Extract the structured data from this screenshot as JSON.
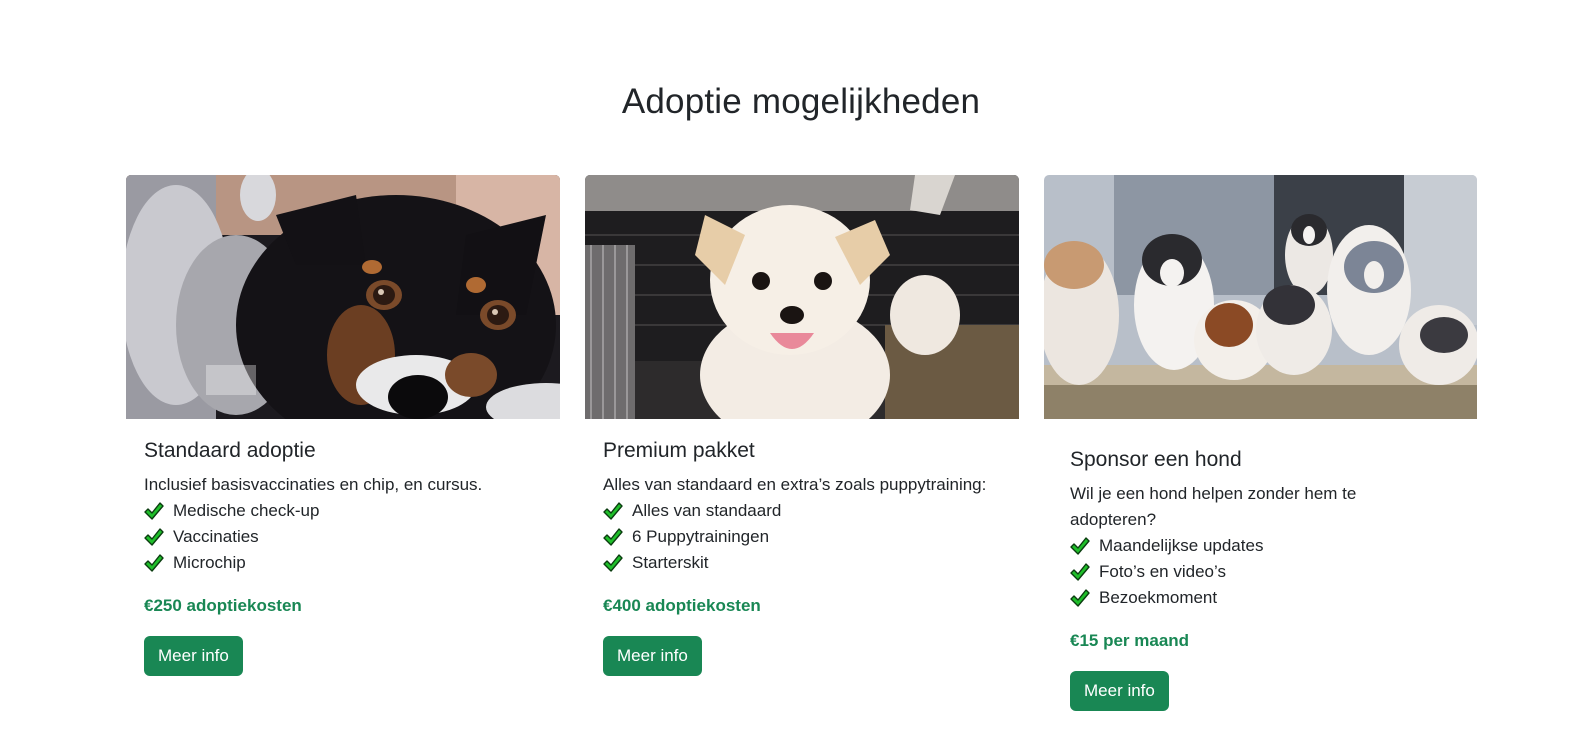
{
  "section": {
    "title": "Adoptie mogelijkheden"
  },
  "cards": [
    {
      "title": "Standaard adoptie",
      "description": "Inclusief basisvaccinaties en chip, en cursus.",
      "features": [
        "Medische check-up",
        "Vaccinaties",
        "Microchip"
      ],
      "price": "€250 adoptiekosten",
      "button": "Meer info",
      "image_icon": "black-dog-photo"
    },
    {
      "title": "Premium pakket",
      "description": "Alles van standaard en extra’s zoals puppytraining:",
      "features": [
        "Alles van standaard",
        "6 Puppytrainingen",
        "Starterskit"
      ],
      "price": "€400 adoptiekosten",
      "button": "Meer info",
      "image_icon": "white-dog-photo"
    },
    {
      "title": "Sponsor een hond",
      "description": "Wil je een hond helpen zonder hem te adopteren?",
      "features": [
        "Maandelijkse updates",
        "Foto’s en video’s",
        "Bezoekmoment"
      ],
      "price": "€15 per maand",
      "button": "Meer info",
      "image_icon": "puppies-photo"
    }
  ],
  "colors": {
    "accent": "#198754",
    "check": "#1fbf2a",
    "text": "#212529"
  },
  "icons": {
    "feature": "checkmark-icon"
  }
}
